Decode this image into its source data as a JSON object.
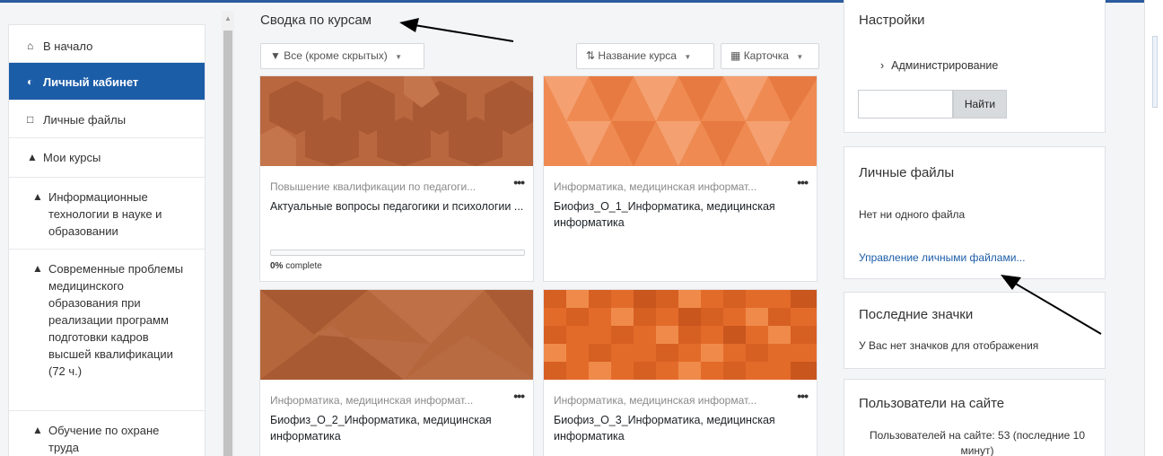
{
  "nav": {
    "home": "В начало",
    "dashboard": "Личный кабинет",
    "private_files": "Личные файлы",
    "my_courses": "Мои курсы",
    "course1": "Информационные технологии в науке и образовании",
    "course2": "Современные проблемы медицинского образования при реализации программ подготовки кадров высшей квалификации (72 ч.)",
    "course3": "Обучение по охране труда"
  },
  "main": {
    "heading": "Сводка по курсам",
    "filter": "Все (кроме скрытых)",
    "sort": "Название курса",
    "view": "Карточка",
    "cards": [
      {
        "category": "Повышение квалификации по педагоги...",
        "name": "Актуальные вопросы педагогики и психологии ...",
        "progress_label": "0%",
        "progress_suffix": " complete",
        "progress": 0
      },
      {
        "category": "Информатика, медицинская информат...",
        "name": "Биофиз_О_1_Информатика, медицинская информатика"
      },
      {
        "category": "Информатика, медицинская информат...",
        "name": "Биофиз_О_2_Информатика, медицинская информатика"
      },
      {
        "category": "Информатика, медицинская информат...",
        "name": "Биофиз_О_3_Информатика, медицинская информатика"
      }
    ],
    "dots": "•••"
  },
  "blocks": {
    "settings": {
      "title": "Настройки",
      "admin": "Администрирование",
      "find_button": "Найти",
      "search_value": ""
    },
    "files": {
      "title": "Личные файлы",
      "empty": "Нет ни одного файла",
      "manage_link": "Управление личными файлами..."
    },
    "badges": {
      "title": "Последние значки",
      "empty": "У Вас нет значков для отображения"
    },
    "online": {
      "title": "Пользователи на сайте",
      "text": "Пользователей на сайте: 53 (последние 10 минут)"
    }
  },
  "colors": {
    "accent": "#1c5da8",
    "card1": "#b9673f",
    "card2": "#ee8a52",
    "card3": "#b5663b",
    "card4": "#e36b2a"
  },
  "icons": {
    "home": "home-icon",
    "dashboard": "tachometer-icon",
    "files": "file-icon",
    "courses": "graduation-cap-icon",
    "filter": "filter-icon",
    "sort": "sort-icon",
    "grid": "grid-icon"
  }
}
